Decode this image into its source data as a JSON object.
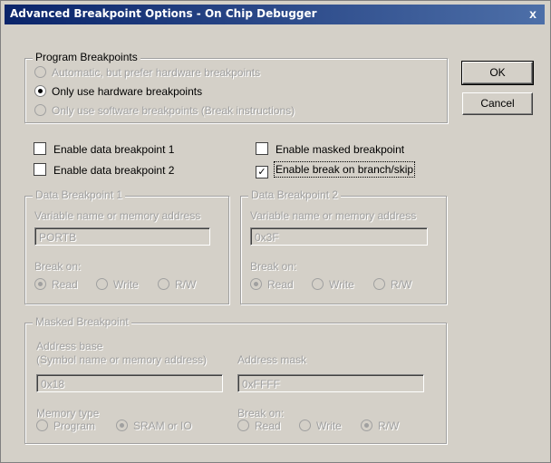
{
  "window": {
    "title": "Advanced Breakpoint Options - On Chip Debugger",
    "close_glyph": "x"
  },
  "buttons": {
    "ok": "OK",
    "cancel": "Cancel"
  },
  "program_breakpoints": {
    "title": "Program Breakpoints",
    "options": [
      {
        "label": "Automatic, but prefer hardware breakpoints",
        "selected": false,
        "enabled": false
      },
      {
        "label": "Only use hardware breakpoints",
        "selected": true,
        "enabled": true
      },
      {
        "label": "Only use software breakpoints (Break instructions)",
        "selected": false,
        "enabled": false
      }
    ]
  },
  "checkboxes": {
    "data_bp1": {
      "label": "Enable data breakpoint 1",
      "checked": false
    },
    "data_bp2": {
      "label": "Enable data breakpoint 2",
      "checked": false
    },
    "masked": {
      "label": "Enable masked breakpoint",
      "checked": false
    },
    "branch": {
      "label": "Enable break on branch/skip",
      "checked": true
    }
  },
  "data_bp1": {
    "title": "Data Breakpoint 1",
    "field_label": "Variable name or memory address",
    "value": "PORTB",
    "break_on_label": "Break on:",
    "read": "Read",
    "write": "Write",
    "rw": "R/W"
  },
  "data_bp2": {
    "title": "Data Breakpoint 2",
    "field_label": "Variable name or memory address",
    "value": "0x3F",
    "break_on_label": "Break on:",
    "read": "Read",
    "write": "Write",
    "rw": "R/W"
  },
  "masked_bp": {
    "title": "Masked Breakpoint",
    "address_base_label": "Address base",
    "address_base_sub": "(Symbol name or memory address)",
    "address_base_value": "0x18",
    "address_mask_label": "Address mask",
    "address_mask_value": "0xFFFF",
    "memory_type_label": "Memory type",
    "program": "Program",
    "sram": "SRAM or IO",
    "break_on_label": "Break on:",
    "read": "Read",
    "write": "Write",
    "rw": "R/W"
  }
}
